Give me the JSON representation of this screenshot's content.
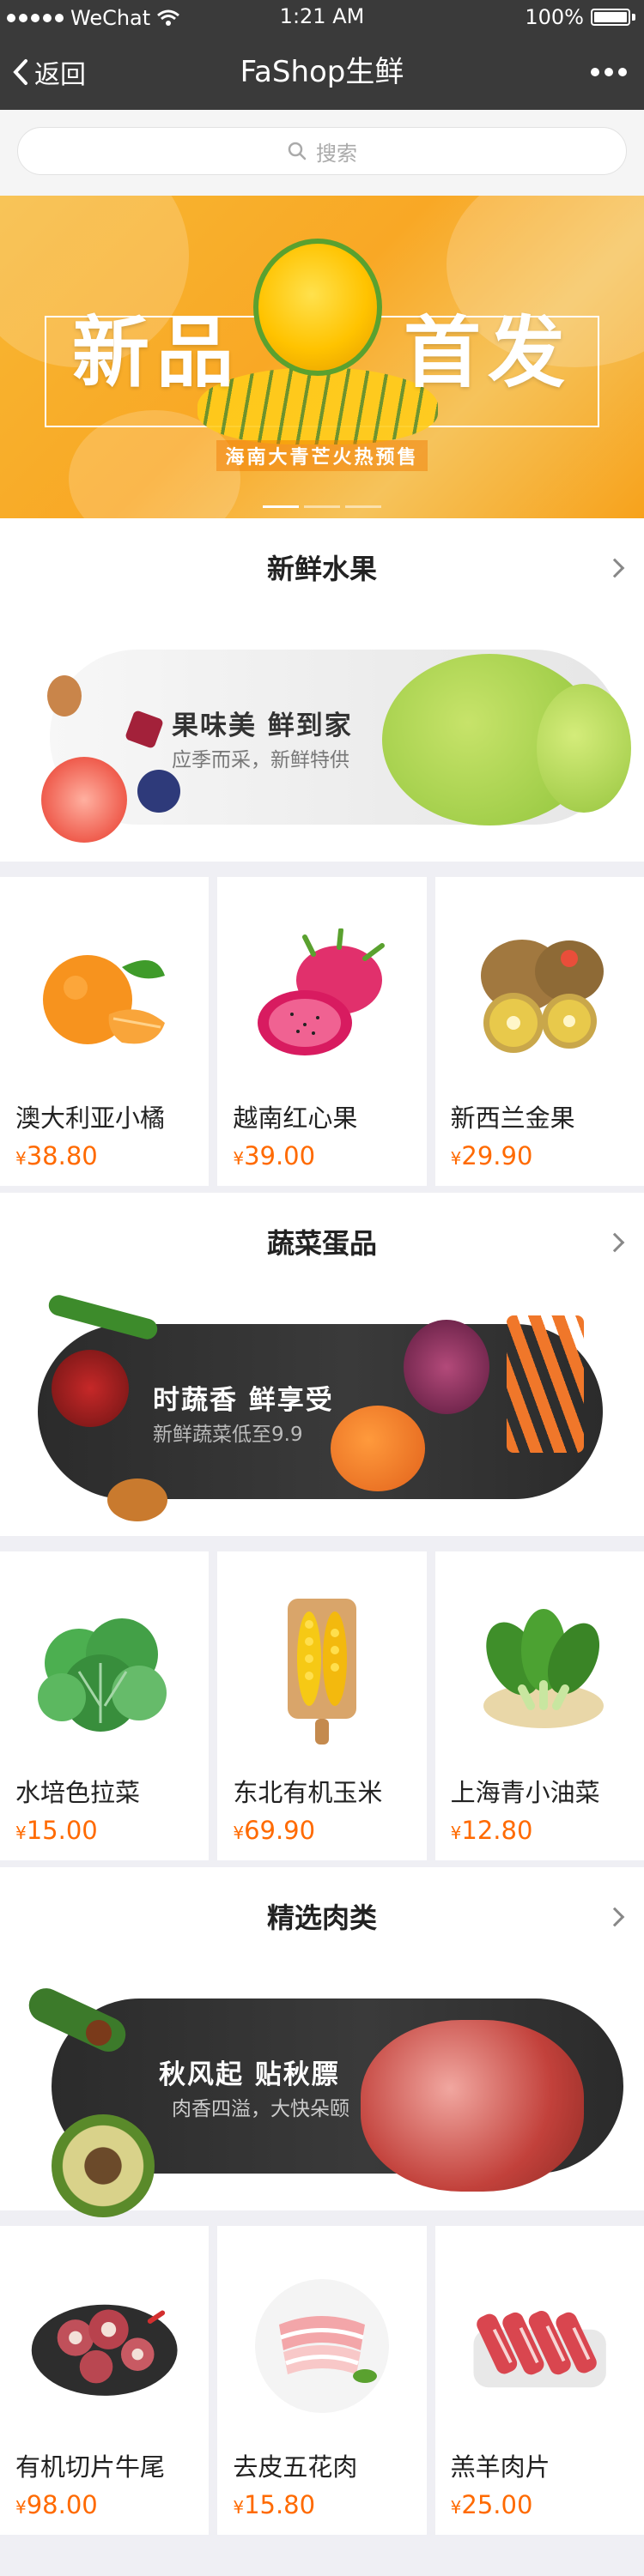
{
  "status_bar": {
    "carrier": "WeChat",
    "time": "1:21 AM",
    "battery": "100%"
  },
  "nav": {
    "back_label": "返回",
    "title": "FaShop生鲜"
  },
  "search": {
    "placeholder": "搜索"
  },
  "banner": {
    "headline_left": "新品",
    "headline_right": "首发",
    "subline": "海南大青芒火热预售",
    "slides": 3,
    "active_slide": 1
  },
  "sections": [
    {
      "title": "新鲜水果",
      "promo": {
        "title": "果味美  鲜到家",
        "subtitle": "应季而采，新鲜特供",
        "theme": "light"
      },
      "products": [
        {
          "name": "澳大利亚小橘",
          "currency": "¥",
          "price": "38.80",
          "icon": "orange-icon"
        },
        {
          "name": "越南红心果",
          "currency": "¥",
          "price": "39.00",
          "icon": "dragonfruit-icon"
        },
        {
          "name": "新西兰金果",
          "currency": "¥",
          "price": "29.90",
          "icon": "kiwi-icon"
        }
      ]
    },
    {
      "title": "蔬菜蛋品",
      "promo": {
        "title": "时蔬香  鲜享受",
        "subtitle": "新鲜蔬菜低至9.9",
        "theme": "dark"
      },
      "products": [
        {
          "name": "水培色拉菜",
          "currency": "¥",
          "price": "15.00",
          "icon": "lettuce-icon"
        },
        {
          "name": "东北有机玉米",
          "currency": "¥",
          "price": "69.90",
          "icon": "corn-icon"
        },
        {
          "name": "上海青小油菜",
          "currency": "¥",
          "price": "12.80",
          "icon": "bokchoy-icon"
        }
      ]
    },
    {
      "title": "精选肉类",
      "promo": {
        "title": "秋风起  贴秋膘",
        "subtitle": "肉香四溢，大快朵颐",
        "theme": "dark"
      },
      "products": [
        {
          "name": "有机切片牛尾",
          "currency": "¥",
          "price": "98.00",
          "icon": "oxtail-icon"
        },
        {
          "name": "去皮五花肉",
          "currency": "¥",
          "price": "15.80",
          "icon": "pork-belly-icon"
        },
        {
          "name": "羔羊肉片",
          "currency": "¥",
          "price": "25.00",
          "icon": "lamb-slices-icon"
        }
      ]
    }
  ],
  "colors": {
    "nav_bg": "#3a3a3a",
    "price": "#ff6a00",
    "page_bg": "#efeff4",
    "banner": "#f9a825"
  }
}
